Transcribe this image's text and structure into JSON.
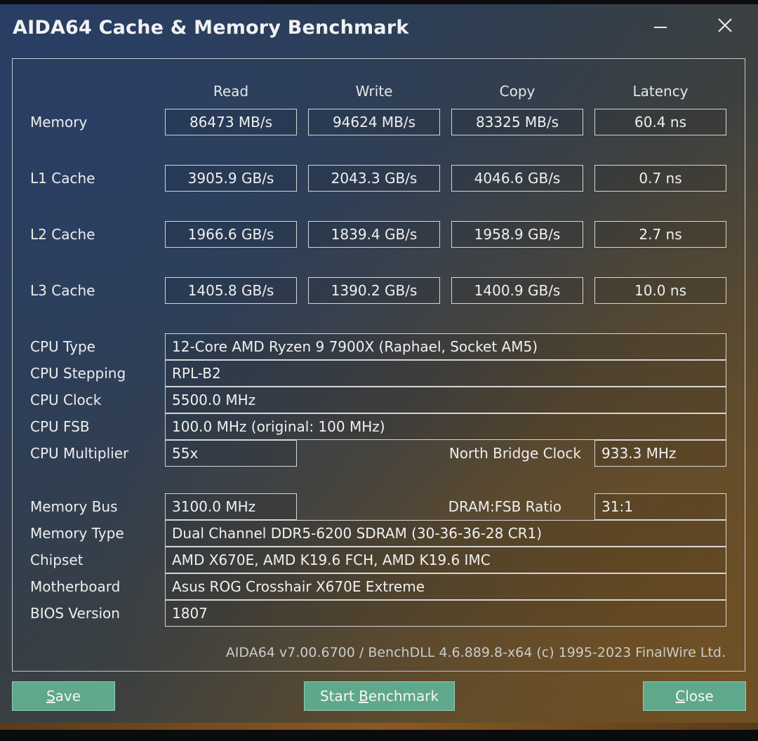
{
  "window": {
    "title": "AIDA64 Cache & Memory Benchmark",
    "minimize_glyph": "—",
    "close_glyph": "✕"
  },
  "columns": [
    "Read",
    "Write",
    "Copy",
    "Latency"
  ],
  "bench_rows": [
    {
      "label": "Memory",
      "values": [
        "86473 MB/s",
        "94624 MB/s",
        "83325 MB/s",
        "60.4 ns"
      ]
    },
    {
      "label": "L1 Cache",
      "values": [
        "3905.9 GB/s",
        "2043.3 GB/s",
        "4046.6 GB/s",
        "0.7 ns"
      ]
    },
    {
      "label": "L2 Cache",
      "values": [
        "1966.6 GB/s",
        "1839.4 GB/s",
        "1958.9 GB/s",
        "2.7 ns"
      ]
    },
    {
      "label": "L3 Cache",
      "values": [
        "1405.8 GB/s",
        "1390.2 GB/s",
        "1400.9 GB/s",
        "10.0 ns"
      ]
    }
  ],
  "info": {
    "cpu_type": {
      "label": "CPU Type",
      "value": "12-Core AMD Ryzen 9 7900X  (Raphael, Socket AM5)"
    },
    "cpu_stepping": {
      "label": "CPU Stepping",
      "value": "RPL-B2"
    },
    "cpu_clock": {
      "label": "CPU Clock",
      "value": "5500.0 MHz"
    },
    "cpu_fsb": {
      "label": "CPU FSB",
      "value": "100.0 MHz  (original: 100 MHz)"
    },
    "cpu_multiplier": {
      "label": "CPU Multiplier",
      "value": "55x"
    },
    "nb_clock": {
      "label": "North Bridge Clock",
      "value": "933.3 MHz"
    },
    "memory_bus": {
      "label": "Memory Bus",
      "value": "3100.0 MHz"
    },
    "dram_ratio": {
      "label": "DRAM:FSB Ratio",
      "value": "31:1"
    },
    "memory_type": {
      "label": "Memory Type",
      "value": "Dual Channel DDR5-6200 SDRAM  (30-36-36-28 CR1)"
    },
    "chipset": {
      "label": "Chipset",
      "value": "AMD X670E, AMD K19.6 FCH, AMD K19.6 IMC"
    },
    "motherboard": {
      "label": "Motherboard",
      "value": "Asus ROG Crosshair X670E Extreme"
    },
    "bios": {
      "label": "BIOS Version",
      "value": "1807"
    }
  },
  "footer": "AIDA64 v7.00.6700 / BenchDLL 4.6.889.8-x64  (c) 1995-2023 FinalWire Ltd.",
  "buttons": {
    "save": {
      "mnemonic": "S",
      "rest": "ave"
    },
    "start": {
      "before": "Start ",
      "mnemonic": "B",
      "rest": "enchmark"
    },
    "close": {
      "mnemonic": "C",
      "rest": "lose"
    }
  }
}
